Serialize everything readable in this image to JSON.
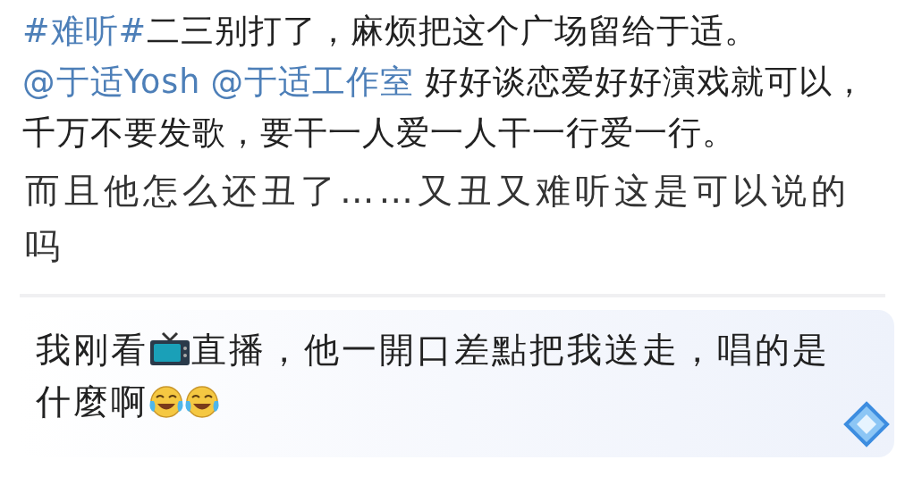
{
  "post": {
    "segments": [
      {
        "kind": "hashtag",
        "text": "#难听#"
      },
      {
        "kind": "text",
        "text": "二三别打了，麻烦把这个广场留给于适。"
      },
      {
        "kind": "mention",
        "text": "@于适Yosh"
      },
      {
        "kind": "mention",
        "text": "@于适工作室"
      },
      {
        "kind": "text",
        "text": " 好好谈恋爱好好演戏就可以，千万不要发歌，要干一人爱一人干一行爱一行。"
      }
    ]
  },
  "reply": {
    "text": "而且他怎么还丑了……又丑又难听这是可以说的吗"
  },
  "comment": {
    "parts": [
      {
        "kind": "text",
        "text": "我刚看"
      },
      {
        "kind": "tv-emoji"
      },
      {
        "kind": "text",
        "text": "直播，他一開口差點把我送走，唱的是什麼啊"
      },
      {
        "kind": "laugh-emoji"
      },
      {
        "kind": "laugh-emoji"
      }
    ]
  }
}
